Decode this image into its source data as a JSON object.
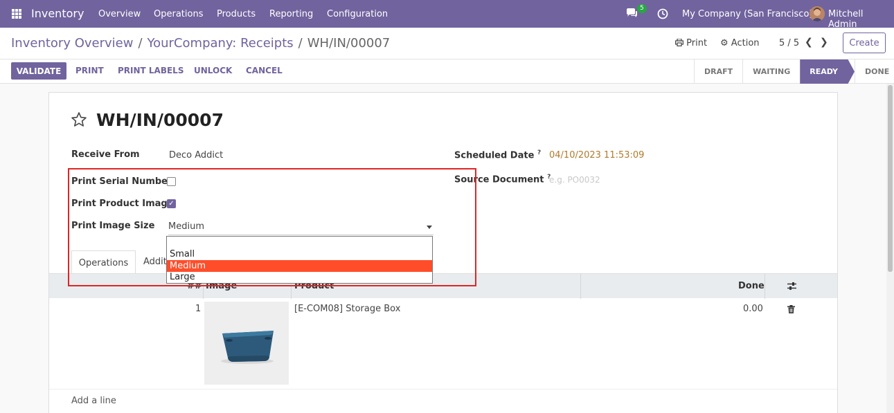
{
  "navbar": {
    "brand": "Inventory",
    "menu": [
      "Overview",
      "Operations",
      "Products",
      "Reporting",
      "Configuration"
    ],
    "chat_badge": "5",
    "company": "My Company (San Francisco)",
    "user": "Mitchell Admin"
  },
  "control_panel": {
    "breadcrumb": [
      "Inventory Overview",
      "YourCompany: Receipts",
      "WH/IN/00007"
    ],
    "print_label": "Print",
    "action_label": "Action",
    "pager": "5 / 5",
    "create_label": "Create"
  },
  "statusbar": {
    "buttons": [
      "VALIDATE",
      "PRINT",
      "PRINT LABELS",
      "UNLOCK",
      "CANCEL"
    ],
    "stages": [
      "DRAFT",
      "WAITING",
      "READY",
      "DONE"
    ],
    "active_stage": "READY"
  },
  "form": {
    "title": "WH/IN/00007",
    "receive_from_label": "Receive From",
    "receive_from_value": "Deco Addict",
    "scheduled_date_label": "Scheduled Date",
    "scheduled_date_value": "04/10/2023 11:53:09",
    "help_mark": "?",
    "source_document_label": "Source Document",
    "source_document_placeholder": "e.g. PO0032",
    "print_serial_label": "Print Serial Number",
    "print_serial_checked": false,
    "print_image_label": "Print Product Image",
    "print_image_checked": true,
    "print_size_label": "Print Image Size",
    "print_size_value": "Medium",
    "size_options": [
      "Small",
      "Medium",
      "Large"
    ],
    "selected_option": "Medium"
  },
  "tabs": [
    "Operations",
    "Additi"
  ],
  "table": {
    "headers": [
      "##",
      "Image",
      "Product",
      "Done"
    ],
    "rows": [
      {
        "index": "1",
        "product": "[E-COM08] Storage Box",
        "done": "0.00"
      }
    ],
    "add_line": "Add a line"
  },
  "colors": {
    "brand": "#71639e",
    "highlight": "#ff4d2a",
    "date": "#b07a2a",
    "annotation": "#e02424"
  }
}
